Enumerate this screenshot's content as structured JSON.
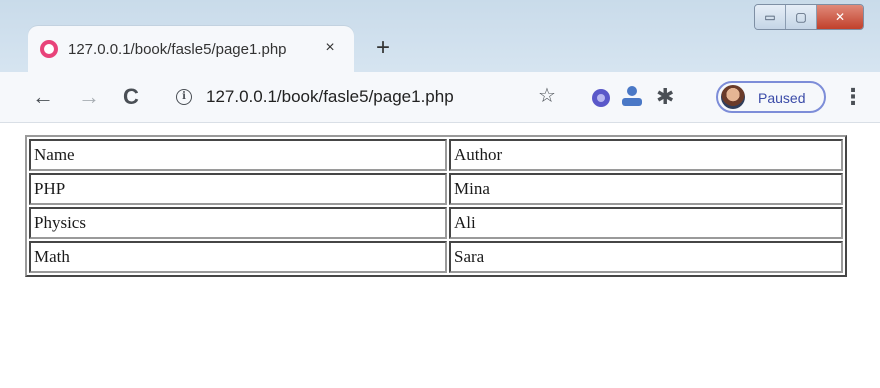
{
  "browser": {
    "tab": {
      "title": "127.0.0.1/book/fasle5/page1.php",
      "close_label": "×"
    },
    "new_tab_label": "+",
    "window_controls": {
      "minimize": "▭",
      "maximize": "▢",
      "close": "✕"
    },
    "toolbar": {
      "back": "←",
      "forward": "→",
      "reload": "C",
      "url": "127.0.0.1/book/fasle5/page1.php",
      "star": "☆",
      "puzzle": "✱",
      "menu": "⋮",
      "profile_status": "Paused"
    }
  },
  "table": {
    "rows": [
      [
        "Name",
        "Author"
      ],
      [
        "PHP",
        "Mina"
      ],
      [
        "Physics",
        "Ali"
      ],
      [
        "Math",
        "Sara"
      ]
    ]
  },
  "icons": {
    "favicon": "favicon-icon",
    "info": "info-icon",
    "extension_1": "extension-icon",
    "extension_2": "profile-upload-icon"
  }
}
